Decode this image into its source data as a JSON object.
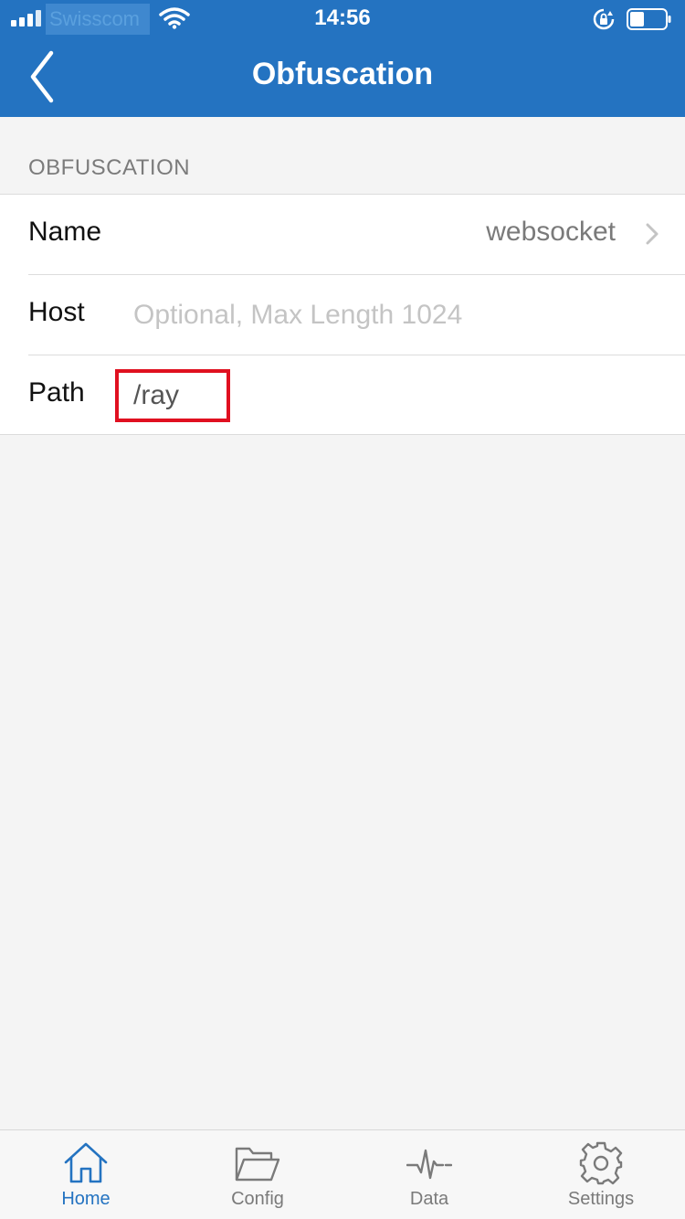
{
  "status_bar": {
    "carrier": "Swisscom",
    "time": "14:56"
  },
  "navbar": {
    "title": "Obfuscation"
  },
  "section": {
    "header": "OBFUSCATION",
    "rows": {
      "name": {
        "label": "Name",
        "value": "websocket"
      },
      "host": {
        "label": "Host",
        "value": "",
        "placeholder": "Optional, Max Length 1024"
      },
      "path": {
        "label": "Path",
        "value": "/ray"
      }
    }
  },
  "tabbar": {
    "home": "Home",
    "config": "Config",
    "data": "Data",
    "settings": "Settings",
    "active": "home"
  },
  "colors": {
    "accent": "#2473c1",
    "highlight_box": "#e01020",
    "background": "#f4f4f4"
  }
}
